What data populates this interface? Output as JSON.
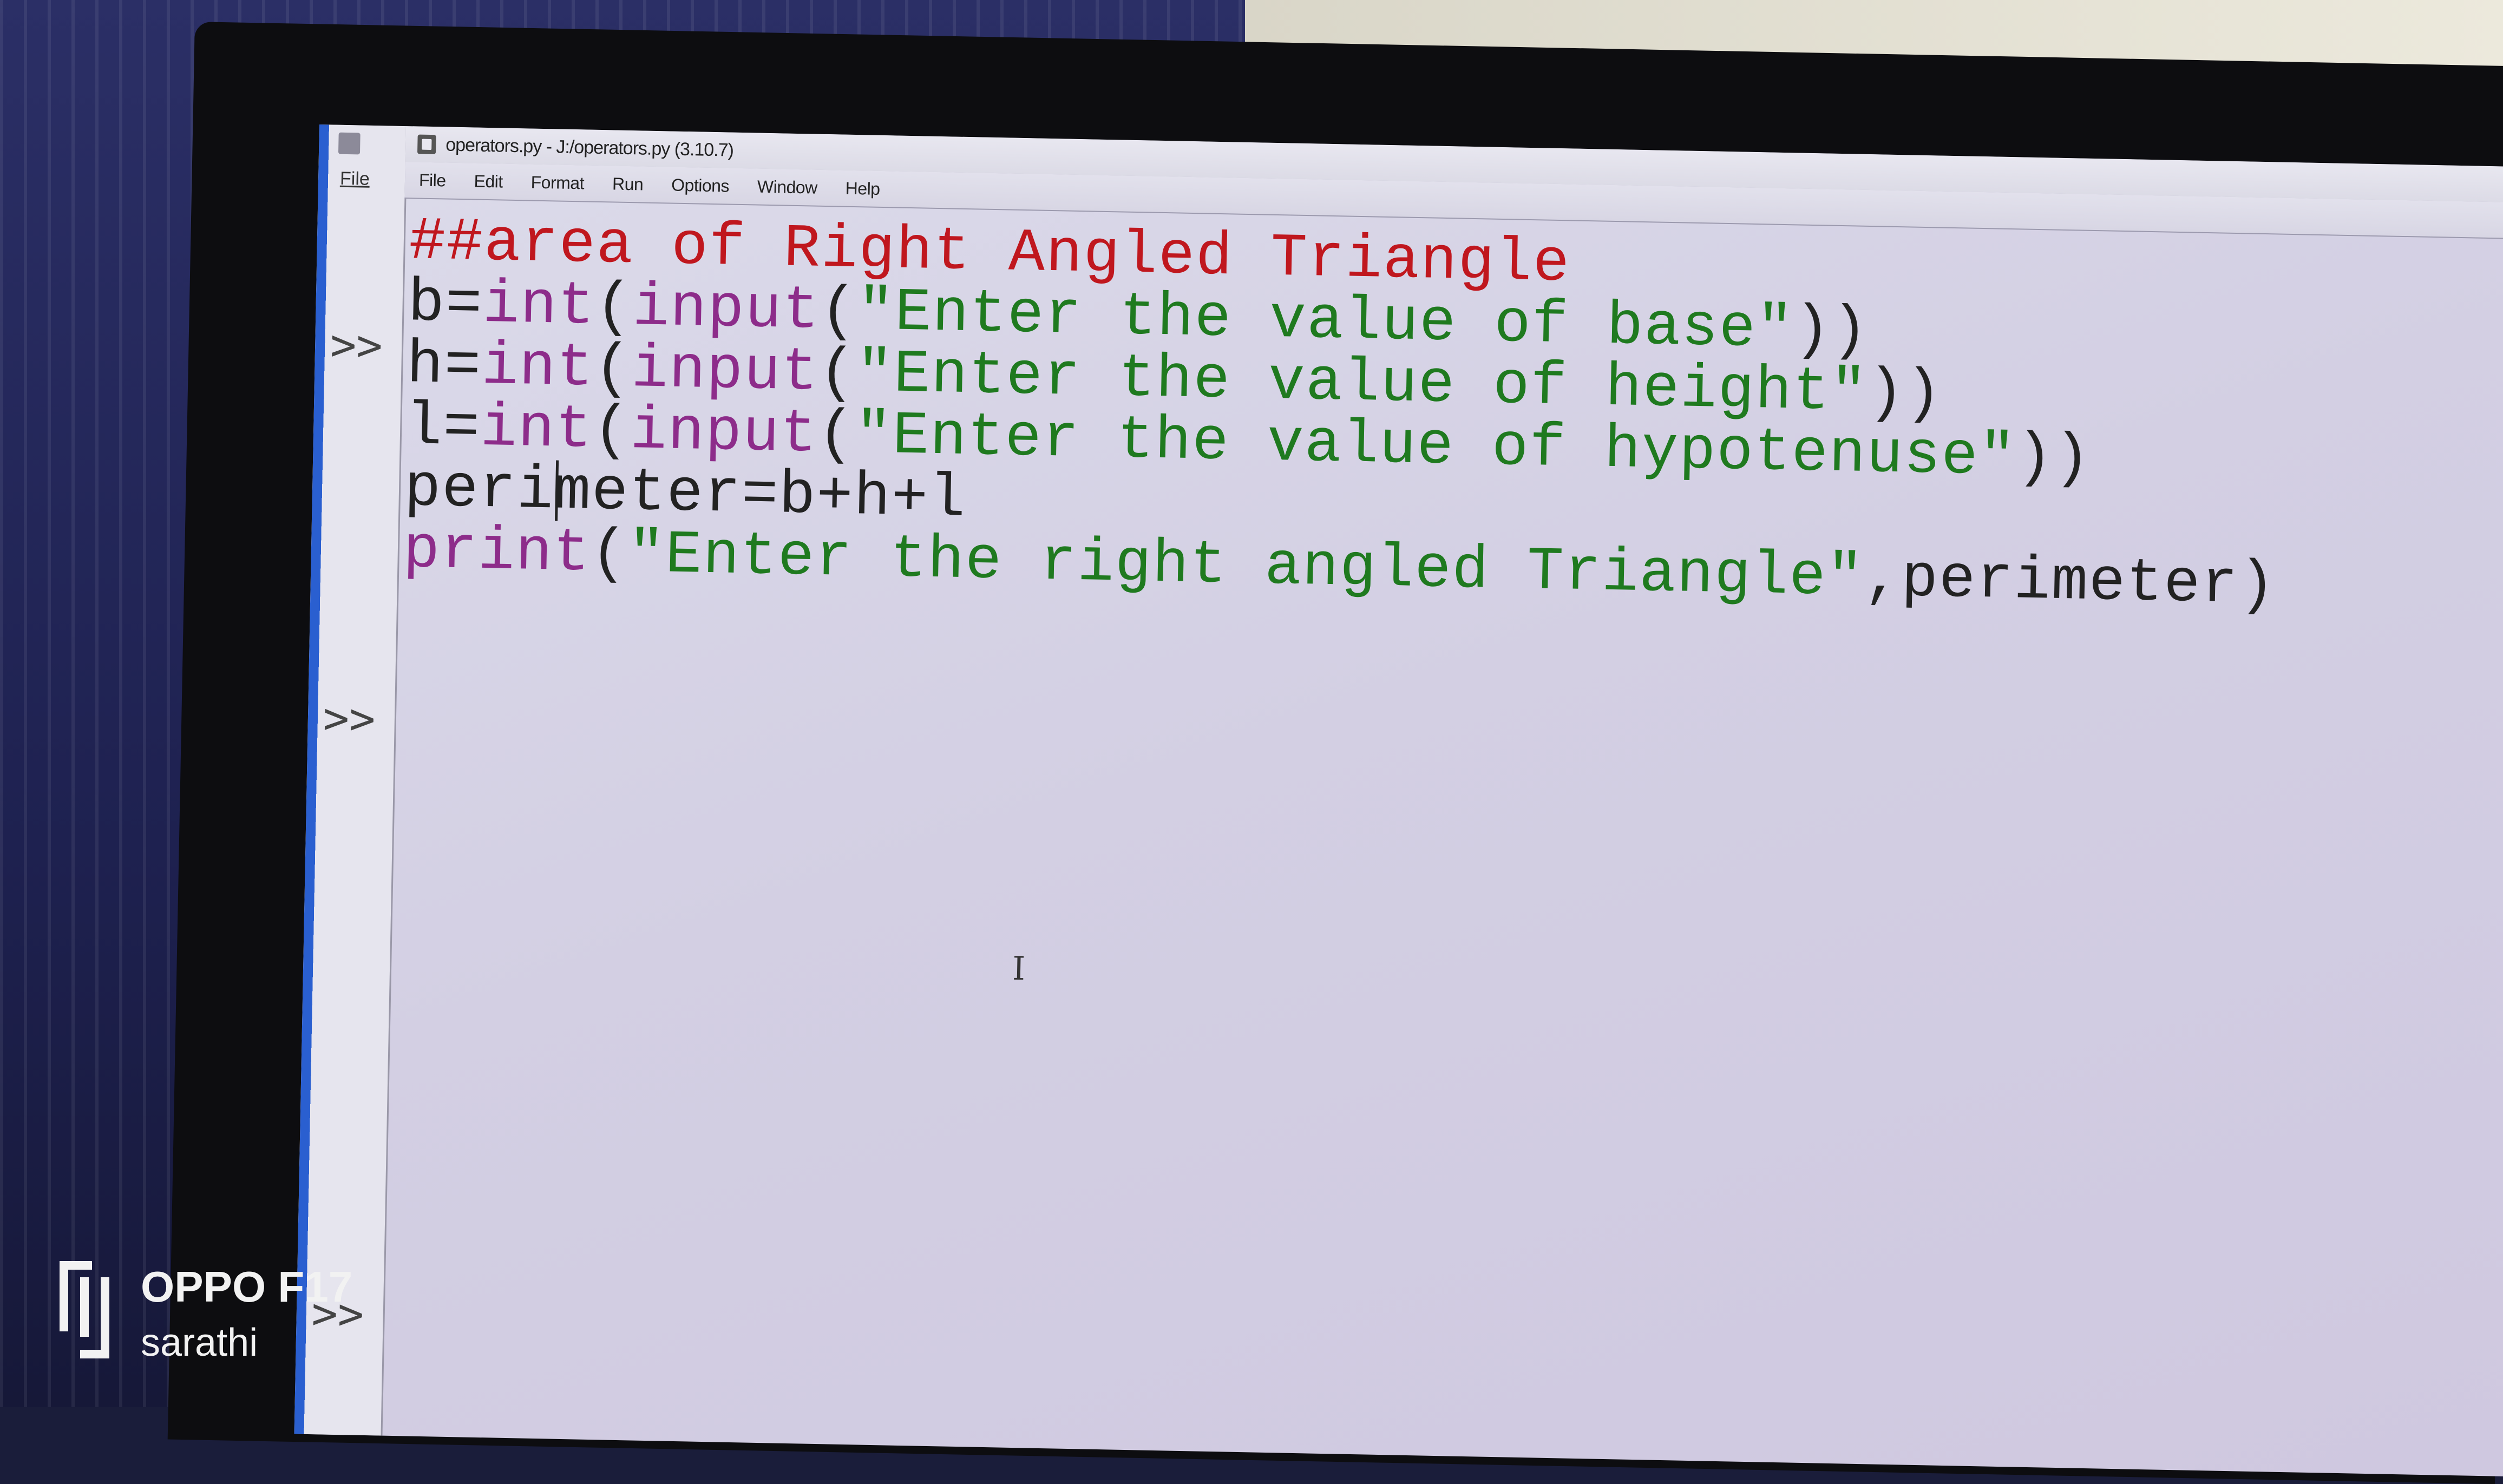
{
  "window": {
    "title": "operators.py - J:/operators.py (3.10.7)"
  },
  "shell": {
    "menu_file": "File",
    "prompt": ">>"
  },
  "menu": [
    "File",
    "Edit",
    "Format",
    "Run",
    "Options",
    "Window",
    "Help"
  ],
  "code_lines": [
    [
      {
        "t": "##area of Right Angled Triangle",
        "k": "comment"
      }
    ],
    [
      {
        "t": "b=",
        "k": "plain"
      },
      {
        "t": "int",
        "k": "builtin"
      },
      {
        "t": "(",
        "k": "plain"
      },
      {
        "t": "input",
        "k": "builtin"
      },
      {
        "t": "(",
        "k": "plain"
      },
      {
        "t": "\"Enter the value of base\"",
        "k": "string"
      },
      {
        "t": "))",
        "k": "plain"
      }
    ],
    [
      {
        "t": "h=",
        "k": "plain"
      },
      {
        "t": "int",
        "k": "builtin"
      },
      {
        "t": "(",
        "k": "plain"
      },
      {
        "t": "input",
        "k": "builtin"
      },
      {
        "t": "(",
        "k": "plain"
      },
      {
        "t": "\"Enter the value of height\"",
        "k": "string"
      },
      {
        "t": "))",
        "k": "plain"
      }
    ],
    [
      {
        "t": "l=",
        "k": "plain"
      },
      {
        "t": "int",
        "k": "builtin"
      },
      {
        "t": "(",
        "k": "plain"
      },
      {
        "t": "input",
        "k": "builtin"
      },
      {
        "t": "(",
        "k": "plain"
      },
      {
        "t": "\"Enter the value of hypotenuse\"",
        "k": "string"
      },
      {
        "t": "))",
        "k": "plain"
      }
    ],
    [
      {
        "t": "perimeter=b+h+l",
        "k": "plain"
      }
    ],
    [
      {
        "t": "print",
        "k": "builtin"
      },
      {
        "t": "(",
        "k": "plain"
      },
      {
        "t": "\"Enter the right angled Triangle\"",
        "k": "string"
      },
      {
        "t": ",perimeter)",
        "k": "plain"
      }
    ]
  ],
  "watermark": {
    "model": "OPPO F17",
    "user": "sarathi"
  },
  "colors": {
    "comment": "#c0171e",
    "builtin": "#8d2c8a",
    "string": "#1f7a1f",
    "plain": "#222222"
  }
}
